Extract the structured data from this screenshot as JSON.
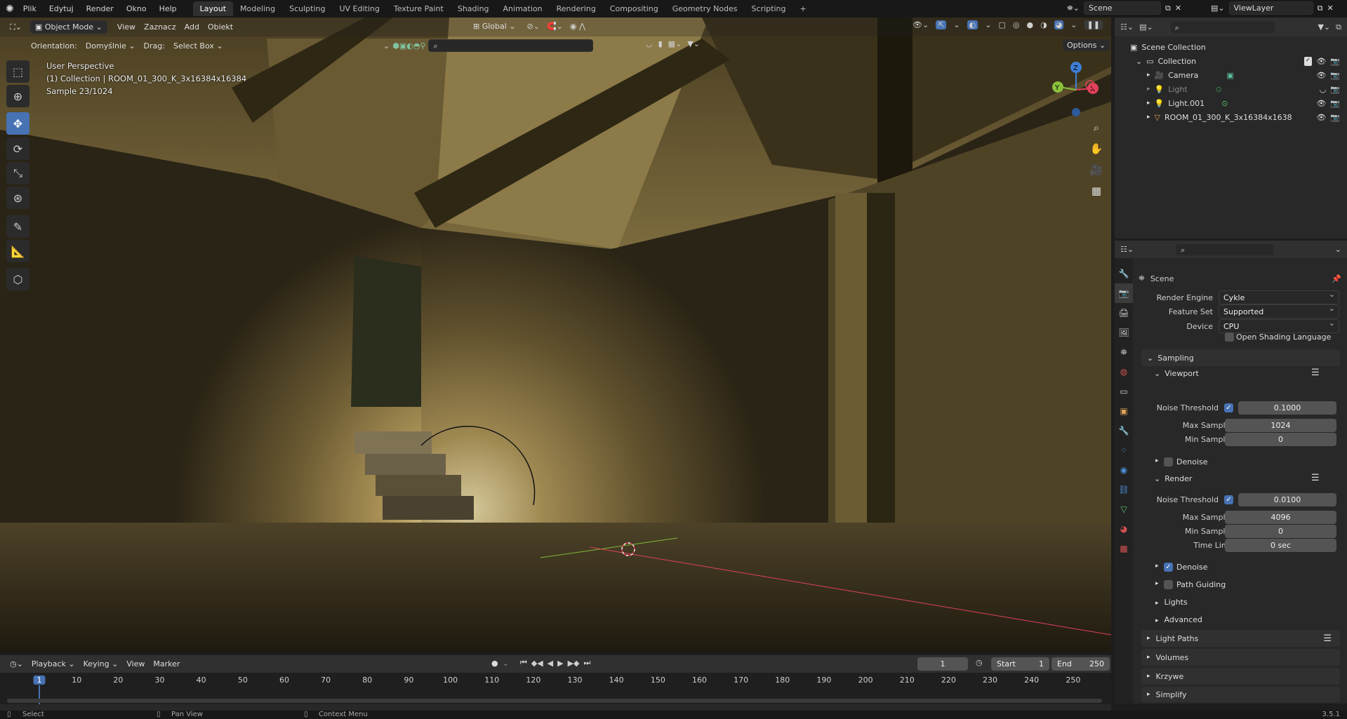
{
  "menu": {
    "items": [
      "Plik",
      "Edytuj",
      "Render",
      "Okno",
      "Help"
    ],
    "workspaces": [
      "Layout",
      "Modeling",
      "Sculpting",
      "UV Editing",
      "Texture Paint",
      "Shading",
      "Animation",
      "Rendering",
      "Compositing",
      "Geometry Nodes",
      "Scripting"
    ],
    "active_workspace": "Layout",
    "add_tab": "+",
    "scene_name": "Scene",
    "view_layer": "ViewLayer"
  },
  "viewport_header": {
    "mode": "Object Mode",
    "menus": [
      "View",
      "Zaznacz",
      "Add",
      "Obiekt"
    ],
    "transform_orientation": "Global",
    "orientation_label": "Orientation:",
    "orientation_value": "Domyślnie",
    "drag_label": "Drag:",
    "drag_value": "Select Box",
    "options": "Options"
  },
  "viewport_overlay": {
    "perspective": "User Perspective",
    "collection": "(1) Collection | ROOM_01_300_K_3x16384x16384",
    "sample": "Sample 23/1024"
  },
  "gizmo": {
    "z": "Z",
    "y": "Y",
    "x": "X"
  },
  "outliner": {
    "root": "Scene Collection",
    "collection": "Collection",
    "objects": [
      "Camera",
      "Light",
      "Light.001",
      "ROOM_01_300_K_3x16384x1638"
    ]
  },
  "properties": {
    "context": "Scene",
    "render_engine_label": "Render Engine",
    "render_engine": "Cykle",
    "feature_set_label": "Feature Set",
    "feature_set": "Supported",
    "device_label": "Device",
    "device": "CPU",
    "osl": "Open Shading Language",
    "sampling": "Sampling",
    "viewport": "Viewport",
    "vp_noise_label": "Noise Threshold",
    "vp_noise": "0.1000",
    "vp_max_label": "Max Samples",
    "vp_max": "1024",
    "vp_min_label": "Min Samples",
    "vp_min": "0",
    "vp_denoise": "Denoise",
    "render": "Render",
    "r_noise_label": "Noise Threshold",
    "r_noise": "0.0100",
    "r_max_label": "Max Samples",
    "r_max": "4096",
    "r_min_label": "Min Samples",
    "r_min": "0",
    "r_time_label": "Time Limit",
    "r_time": "0 sec",
    "r_denoise": "Denoise",
    "path_guiding": "Path Guiding",
    "lights": "Lights",
    "advanced": "Advanced",
    "light_paths": "Light Paths",
    "volumes": "Volumes",
    "curves": "Krzywe",
    "simplify": "Simplify"
  },
  "timeline": {
    "menus": [
      "Playback",
      "Keying",
      "View",
      "Marker"
    ],
    "current_frame": "1",
    "start_label": "Start",
    "start": "1",
    "end_label": "End",
    "end": "250",
    "ticks": [
      "1",
      "10",
      "20",
      "30",
      "40",
      "50",
      "60",
      "70",
      "80",
      "90",
      "100",
      "110",
      "120",
      "130",
      "140",
      "150",
      "160",
      "170",
      "180",
      "190",
      "200",
      "210",
      "220",
      "230",
      "240",
      "250"
    ],
    "playhead": "1"
  },
  "statusbar": {
    "select": "Select",
    "pan": "Pan View",
    "context": "Context Menu",
    "version": "3.5.1"
  },
  "colors": {
    "accent": "#4772b3",
    "active_tool": "#4772b3",
    "x_axis": "#e0415a",
    "y_axis": "#89c13c",
    "z_axis": "#3d7fd6"
  }
}
